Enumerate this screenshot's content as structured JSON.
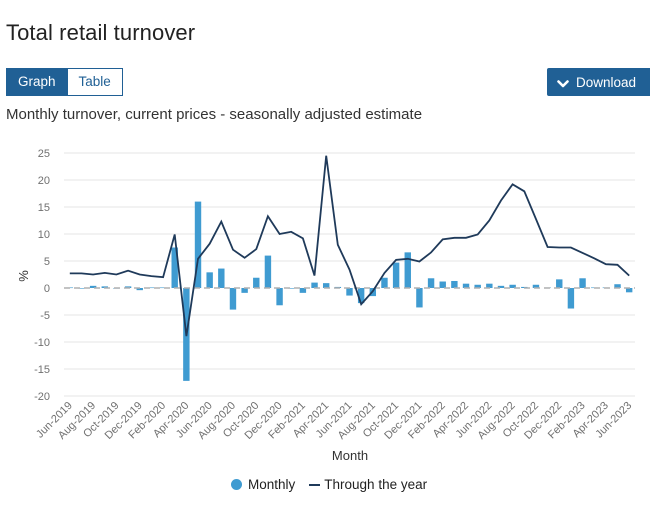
{
  "page": {
    "title": "Total retail turnover",
    "tabs": [
      {
        "label": "Graph",
        "active": true
      },
      {
        "label": "Table",
        "active": false
      }
    ],
    "download_label": "Download",
    "download_icon": "chevron-down-icon",
    "subtitle": "Monthly turnover, current prices - seasonally adjusted estimate"
  },
  "colors": {
    "brand": "#206095",
    "bar": "#3f9bd1",
    "line": "#1f3a5a",
    "zero_line": "#b0b0b0",
    "grid": "#e6e6e6"
  },
  "legend": [
    {
      "label": "Monthly",
      "marker": "dot"
    },
    {
      "label": "Through the year",
      "marker": "line"
    }
  ],
  "chart_data": {
    "type": "bar+line",
    "title": "Monthly turnover, current prices - seasonally adjusted estimate",
    "xlabel": "Month",
    "ylabel": "%",
    "ylim": [
      -20,
      25
    ],
    "yticks": [
      25,
      20,
      15,
      10,
      5,
      0,
      -5,
      -10,
      -15,
      -20
    ],
    "grid": true,
    "legend_position": "bottom",
    "x": [
      "Jun-2019",
      "Jul-2019",
      "Aug-2019",
      "Sep-2019",
      "Oct-2019",
      "Nov-2019",
      "Dec-2019",
      "Jan-2020",
      "Feb-2020",
      "Mar-2020",
      "Apr-2020",
      "May-2020",
      "Jun-2020",
      "Jul-2020",
      "Aug-2020",
      "Sep-2020",
      "Oct-2020",
      "Nov-2020",
      "Dec-2020",
      "Jan-2021",
      "Feb-2021",
      "Mar-2021",
      "Apr-2021",
      "May-2021",
      "Jun-2021",
      "Jul-2021",
      "Aug-2021",
      "Sep-2021",
      "Oct-2021",
      "Nov-2021",
      "Dec-2021",
      "Jan-2022",
      "Feb-2022",
      "Mar-2022",
      "Apr-2022",
      "May-2022",
      "Jun-2022",
      "Jul-2022",
      "Aug-2022",
      "Sep-2022",
      "Oct-2022",
      "Nov-2022",
      "Dec-2022",
      "Jan-2023",
      "Feb-2023",
      "Mar-2023",
      "Apr-2023",
      "May-2023",
      "Jun-2023"
    ],
    "xtick_labels": [
      "Jun-2019",
      "Aug-2019",
      "Oct-2019",
      "Dec-2019",
      "Feb-2020",
      "Apr-2020",
      "Jun-2020",
      "Aug-2020",
      "Oct-2020",
      "Dec-2020",
      "Feb-2021",
      "Apr-2021",
      "Jun-2021",
      "Aug-2021",
      "Oct-2021",
      "Dec-2021",
      "Feb-2022",
      "Apr-2022",
      "Jun-2022",
      "Aug-2022",
      "Oct-2022",
      "Dec-2022",
      "Feb-2023",
      "Apr-2023",
      "Jun-2023"
    ],
    "series": [
      {
        "name": "Monthly",
        "type": "bar",
        "values": [
          0.1,
          0.0,
          0.4,
          0.3,
          0.0,
          0.3,
          -0.4,
          0.1,
          0.1,
          7.5,
          -17.2,
          16.0,
          2.9,
          3.6,
          -4.0,
          -0.9,
          1.9,
          6.0,
          -3.2,
          0.0,
          -0.9,
          1.0,
          0.9,
          0.2,
          -1.4,
          -2.8,
          -1.5,
          1.9,
          4.7,
          6.6,
          -3.6,
          1.8,
          1.2,
          1.3,
          0.8,
          0.6,
          0.8,
          0.4,
          0.6,
          0.2,
          0.6,
          0.1,
          1.6,
          -3.8,
          1.8,
          0.1,
          0.1,
          0.7,
          -0.8
        ]
      },
      {
        "name": "Through the year",
        "type": "line",
        "values": [
          2.7,
          2.7,
          2.5,
          2.8,
          2.5,
          3.2,
          2.5,
          2.2,
          2.0,
          9.9,
          -8.9,
          5.4,
          8.2,
          12.3,
          7.1,
          5.6,
          7.2,
          13.3,
          10.0,
          10.4,
          9.2,
          2.3,
          24.5,
          8.0,
          3.4,
          -3.0,
          -0.6,
          2.8,
          5.2,
          5.4,
          4.9,
          6.6,
          9.0,
          9.3,
          9.3,
          9.9,
          12.5,
          16.2,
          19.2,
          17.9,
          12.8,
          7.6,
          7.5,
          7.5,
          6.5,
          5.5,
          4.4,
          4.3,
          2.3
        ]
      }
    ]
  }
}
